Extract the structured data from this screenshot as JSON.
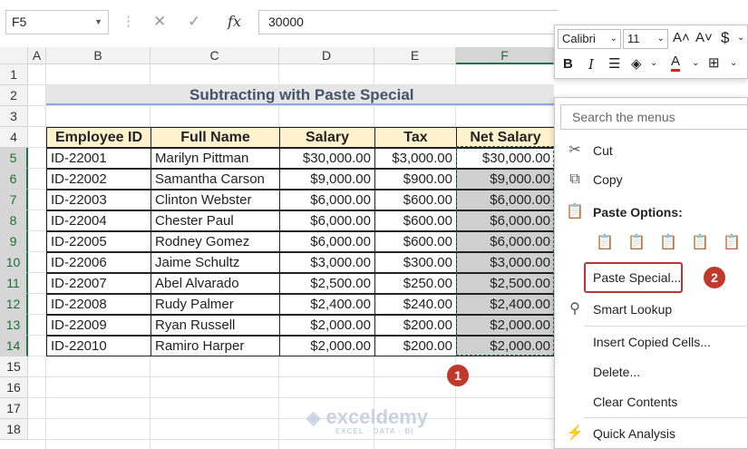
{
  "formula_bar": {
    "name_box": "F5",
    "formula": "30000",
    "fx": "fx"
  },
  "columns": [
    "A",
    "B",
    "C",
    "D",
    "E",
    "F"
  ],
  "rows": [
    "1",
    "2",
    "3",
    "4",
    "5",
    "6",
    "7",
    "8",
    "9",
    "10",
    "11",
    "12",
    "13",
    "14",
    "15",
    "16",
    "17",
    "18"
  ],
  "title": "Subtracting with Paste Special",
  "table": {
    "headers": [
      "Employee ID",
      "Full Name",
      "Salary",
      "Tax",
      "Net Salary"
    ],
    "rows": [
      [
        "ID-22001",
        "Marilyn Pittman",
        "$30,000.00",
        "$3,000.00",
        "$30,000.00"
      ],
      [
        "ID-22002",
        "Samantha Carson",
        "$9,000.00",
        "$900.00",
        "$9,000.00"
      ],
      [
        "ID-22003",
        "Clinton Webster",
        "$6,000.00",
        "$600.00",
        "$6,000.00"
      ],
      [
        "ID-22004",
        "Chester Paul",
        "$6,000.00",
        "$600.00",
        "$6,000.00"
      ],
      [
        "ID-22005",
        "Rodney Gomez",
        "$6,000.00",
        "$600.00",
        "$6,000.00"
      ],
      [
        "ID-22006",
        "Jaime Schultz",
        "$3,000.00",
        "$300.00",
        "$3,000.00"
      ],
      [
        "ID-22007",
        "Abel Alvarado",
        "$2,500.00",
        "$250.00",
        "$2,500.00"
      ],
      [
        "ID-22008",
        "Rudy Palmer",
        "$2,400.00",
        "$240.00",
        "$2,400.00"
      ],
      [
        "ID-22009",
        "Ryan Russell",
        "$2,000.00",
        "$200.00",
        "$2,000.00"
      ],
      [
        "ID-22010",
        "Ramiro Harper",
        "$2,000.00",
        "$200.00",
        "$2,000.00"
      ]
    ]
  },
  "mini_toolbar": {
    "font": "Calibri",
    "size": "11",
    "grow": "A˄",
    "shrink": "A˅",
    "currency": "$",
    "bold": "B",
    "italic": "I",
    "font_color_letter": "A"
  },
  "context_menu": {
    "search_placeholder": "Search the menus",
    "cut": "Cut",
    "copy": "Copy",
    "paste_options": "Paste Options:",
    "paste_special": "Paste Special...",
    "smart_lookup": "Smart Lookup",
    "insert_copied": "Insert Copied Cells...",
    "delete": "Delete...",
    "clear_contents": "Clear Contents",
    "quick_analysis": "Quick Analysis"
  },
  "badges": {
    "one": "1",
    "two": "2"
  },
  "watermark": {
    "name": "exceldemy",
    "tagline": "EXCEL · DATA · BI"
  },
  "colors": {
    "accent": "#217346",
    "header_fill": "#fff2cc",
    "badge": "#c0392b"
  }
}
